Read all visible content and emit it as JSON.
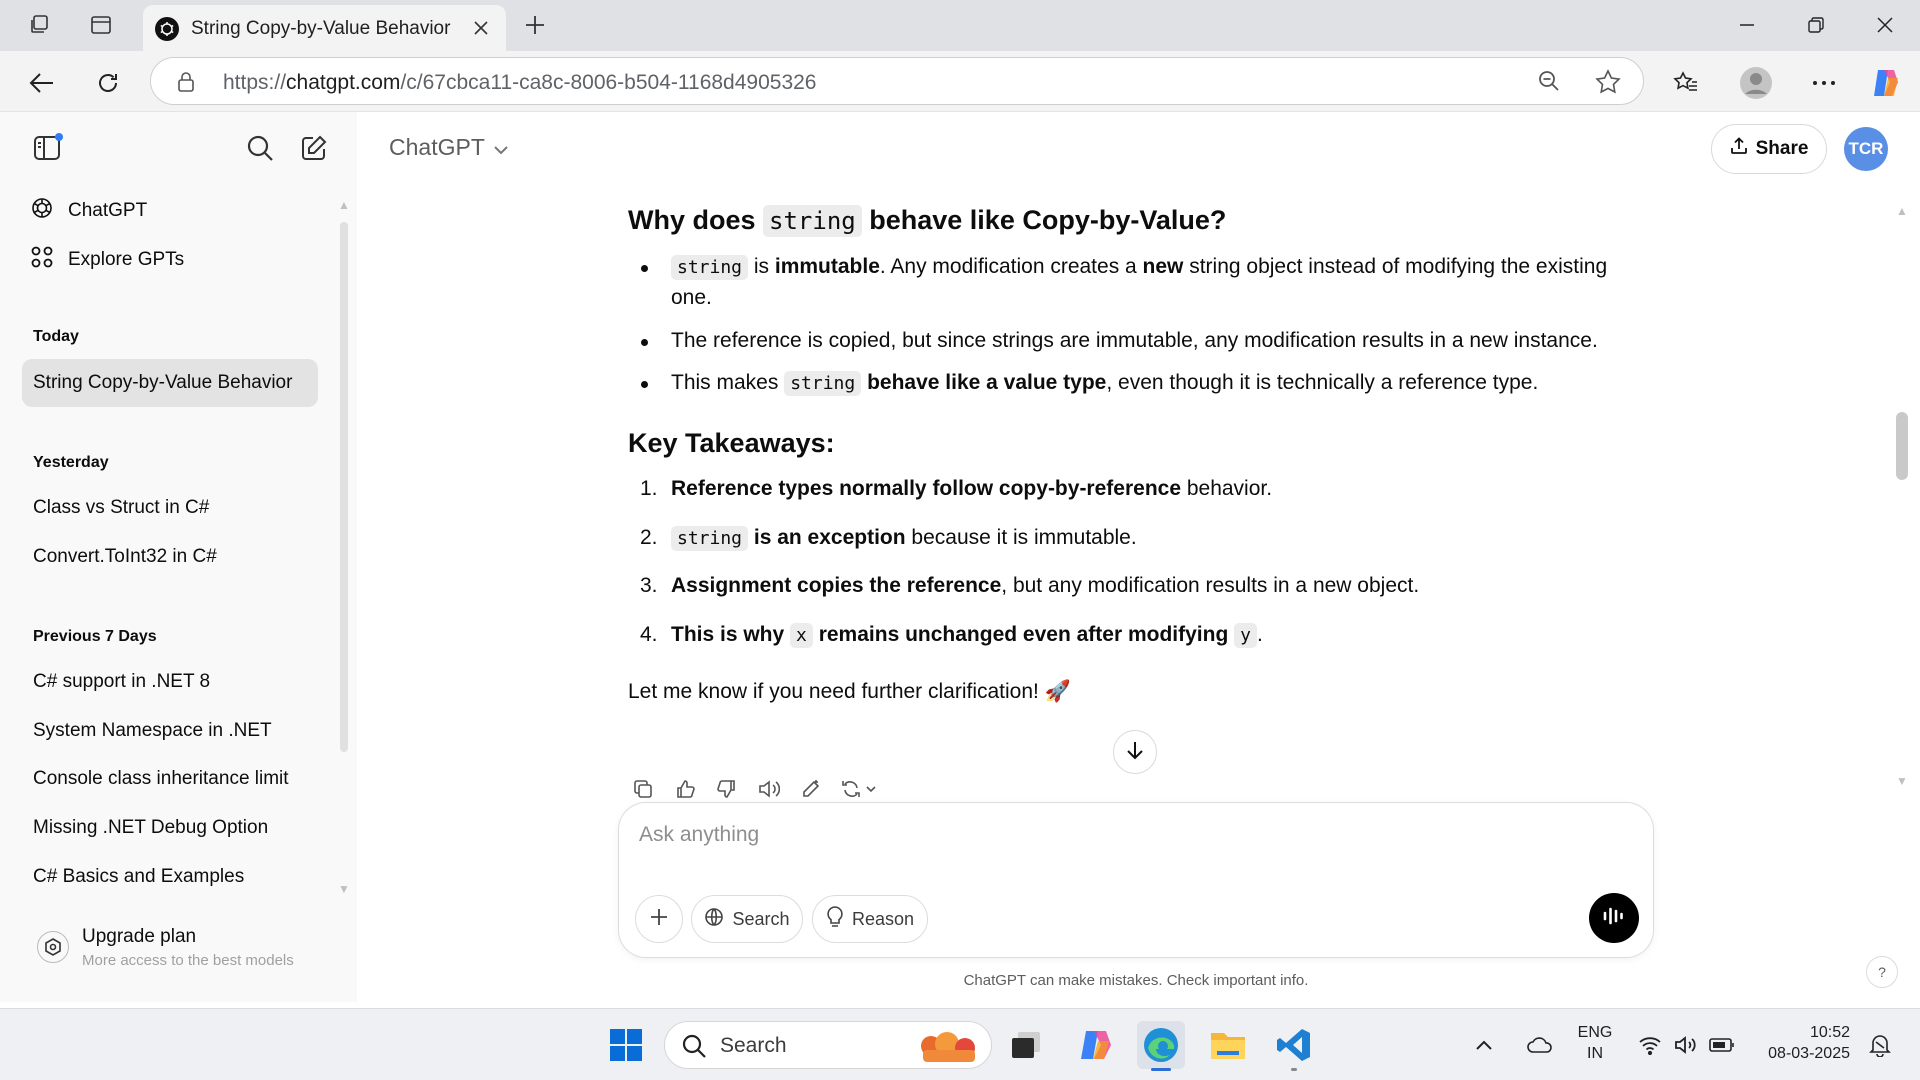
{
  "browser": {
    "tab_title": "String Copy-by-Value Behavior",
    "url_prefix": "https://",
    "url_domain": "chatgpt.com",
    "url_path": "/c/67cbca11-ca8c-8006-b504-1168d4905326"
  },
  "sidebar": {
    "nav": [
      {
        "label": "ChatGPT",
        "icon": "openai-logo-icon"
      },
      {
        "label": "Explore GPTs",
        "icon": "grid-icon"
      }
    ],
    "sections": [
      {
        "title": "Today",
        "items": [
          "String Copy-by-Value Behavior"
        ]
      },
      {
        "title": "Yesterday",
        "items": [
          "Class vs Struct in C#",
          "Convert.ToInt32 in C#"
        ]
      },
      {
        "title": "Previous 7 Days",
        "items": [
          "C# support in .NET 8",
          "System Namespace in .NET",
          "Console class inheritance limit",
          "Missing .NET Debug Option",
          "C# Basics and Examples"
        ]
      }
    ],
    "upgrade": {
      "title": "Upgrade plan",
      "subtitle": "More access to the best models"
    }
  },
  "header": {
    "model": "ChatGPT",
    "share_label": "Share",
    "avatar_initials": "TCR"
  },
  "message": {
    "heading1_pre": "Why does",
    "heading1_code": "string",
    "heading1_post": "behave like Copy-by-Value?",
    "bullets": {
      "b1_code": "string",
      "b1_mid": " is ",
      "b1_bold": "immutable",
      "b1_text": ". Any modification creates a ",
      "b1_bold2": "new",
      "b1_end": " string object instead of modifying the existing one.",
      "b2": "The reference is copied, but since strings are immutable, any modification results in a new instance.",
      "b3_pre": "This makes ",
      "b3_code": "string",
      "b3_bold": " behave like a value type",
      "b3_end": ", even though it is technically a reference type."
    },
    "heading2": "Key Takeaways:",
    "takeaways": {
      "t1_num": "1.",
      "t1_bold": "Reference types normally follow copy-by-reference",
      "t1_end": " behavior.",
      "t2_num": "2.",
      "t2_code": "string",
      "t2_bold": " is an exception",
      "t2_end": " because it is immutable.",
      "t3_num": "3.",
      "t3_bold": "Assignment copies the reference",
      "t3_end": ", but any modification results in a new object.",
      "t4_num": "4.",
      "t4_bold1": "This is why ",
      "t4_code1": "x",
      "t4_bold2": " remains unchanged even after modifying ",
      "t4_code2": "y",
      "t4_end": "."
    },
    "closing": "Let me know if you need further clarification! 🚀"
  },
  "composer": {
    "placeholder": "Ask anything",
    "search_label": "Search",
    "reason_label": "Reason",
    "disclaimer": "ChatGPT can make mistakes. Check important info.",
    "help": "?"
  },
  "taskbar": {
    "search_label": "Search",
    "lang_line1": "ENG",
    "lang_line2": "IN",
    "time": "10:52",
    "date": "08-03-2025"
  },
  "colors": {
    "avatar": "#5a8fe6",
    "sidebar_bg": "#f9f9f9",
    "active_item": "#e3e3e3",
    "tabstrip": "#dfe1e5"
  }
}
